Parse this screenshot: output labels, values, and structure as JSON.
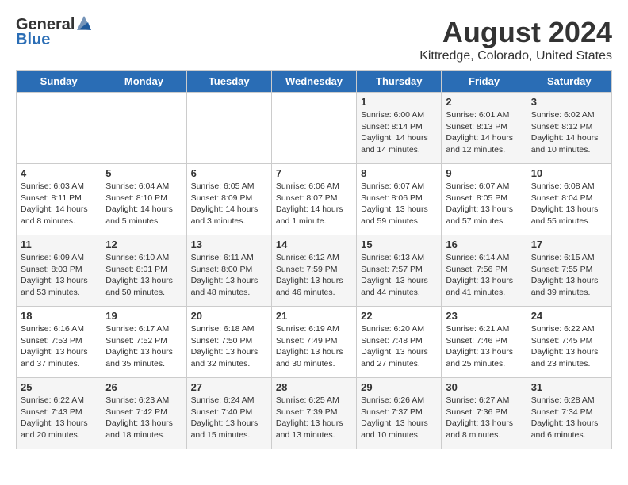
{
  "header": {
    "logo_general": "General",
    "logo_blue": "Blue",
    "month_year": "August 2024",
    "location": "Kittredge, Colorado, United States"
  },
  "days_of_week": [
    "Sunday",
    "Monday",
    "Tuesday",
    "Wednesday",
    "Thursday",
    "Friday",
    "Saturday"
  ],
  "weeks": [
    [
      {
        "date": "",
        "sunrise": "",
        "sunset": "",
        "daylight": ""
      },
      {
        "date": "",
        "sunrise": "",
        "sunset": "",
        "daylight": ""
      },
      {
        "date": "",
        "sunrise": "",
        "sunset": "",
        "daylight": ""
      },
      {
        "date": "",
        "sunrise": "",
        "sunset": "",
        "daylight": ""
      },
      {
        "date": "1",
        "sunrise": "6:00 AM",
        "sunset": "8:14 PM",
        "daylight": "14 hours and 14 minutes."
      },
      {
        "date": "2",
        "sunrise": "6:01 AM",
        "sunset": "8:13 PM",
        "daylight": "14 hours and 12 minutes."
      },
      {
        "date": "3",
        "sunrise": "6:02 AM",
        "sunset": "8:12 PM",
        "daylight": "14 hours and 10 minutes."
      }
    ],
    [
      {
        "date": "4",
        "sunrise": "6:03 AM",
        "sunset": "8:11 PM",
        "daylight": "14 hours and 8 minutes."
      },
      {
        "date": "5",
        "sunrise": "6:04 AM",
        "sunset": "8:10 PM",
        "daylight": "14 hours and 5 minutes."
      },
      {
        "date": "6",
        "sunrise": "6:05 AM",
        "sunset": "8:09 PM",
        "daylight": "14 hours and 3 minutes."
      },
      {
        "date": "7",
        "sunrise": "6:06 AM",
        "sunset": "8:07 PM",
        "daylight": "14 hours and 1 minute."
      },
      {
        "date": "8",
        "sunrise": "6:07 AM",
        "sunset": "8:06 PM",
        "daylight": "13 hours and 59 minutes."
      },
      {
        "date": "9",
        "sunrise": "6:07 AM",
        "sunset": "8:05 PM",
        "daylight": "13 hours and 57 minutes."
      },
      {
        "date": "10",
        "sunrise": "6:08 AM",
        "sunset": "8:04 PM",
        "daylight": "13 hours and 55 minutes."
      }
    ],
    [
      {
        "date": "11",
        "sunrise": "6:09 AM",
        "sunset": "8:03 PM",
        "daylight": "13 hours and 53 minutes."
      },
      {
        "date": "12",
        "sunrise": "6:10 AM",
        "sunset": "8:01 PM",
        "daylight": "13 hours and 50 minutes."
      },
      {
        "date": "13",
        "sunrise": "6:11 AM",
        "sunset": "8:00 PM",
        "daylight": "13 hours and 48 minutes."
      },
      {
        "date": "14",
        "sunrise": "6:12 AM",
        "sunset": "7:59 PM",
        "daylight": "13 hours and 46 minutes."
      },
      {
        "date": "15",
        "sunrise": "6:13 AM",
        "sunset": "7:57 PM",
        "daylight": "13 hours and 44 minutes."
      },
      {
        "date": "16",
        "sunrise": "6:14 AM",
        "sunset": "7:56 PM",
        "daylight": "13 hours and 41 minutes."
      },
      {
        "date": "17",
        "sunrise": "6:15 AM",
        "sunset": "7:55 PM",
        "daylight": "13 hours and 39 minutes."
      }
    ],
    [
      {
        "date": "18",
        "sunrise": "6:16 AM",
        "sunset": "7:53 PM",
        "daylight": "13 hours and 37 minutes."
      },
      {
        "date": "19",
        "sunrise": "6:17 AM",
        "sunset": "7:52 PM",
        "daylight": "13 hours and 35 minutes."
      },
      {
        "date": "20",
        "sunrise": "6:18 AM",
        "sunset": "7:50 PM",
        "daylight": "13 hours and 32 minutes."
      },
      {
        "date": "21",
        "sunrise": "6:19 AM",
        "sunset": "7:49 PM",
        "daylight": "13 hours and 30 minutes."
      },
      {
        "date": "22",
        "sunrise": "6:20 AM",
        "sunset": "7:48 PM",
        "daylight": "13 hours and 27 minutes."
      },
      {
        "date": "23",
        "sunrise": "6:21 AM",
        "sunset": "7:46 PM",
        "daylight": "13 hours and 25 minutes."
      },
      {
        "date": "24",
        "sunrise": "6:22 AM",
        "sunset": "7:45 PM",
        "daylight": "13 hours and 23 minutes."
      }
    ],
    [
      {
        "date": "25",
        "sunrise": "6:22 AM",
        "sunset": "7:43 PM",
        "daylight": "13 hours and 20 minutes."
      },
      {
        "date": "26",
        "sunrise": "6:23 AM",
        "sunset": "7:42 PM",
        "daylight": "13 hours and 18 minutes."
      },
      {
        "date": "27",
        "sunrise": "6:24 AM",
        "sunset": "7:40 PM",
        "daylight": "13 hours and 15 minutes."
      },
      {
        "date": "28",
        "sunrise": "6:25 AM",
        "sunset": "7:39 PM",
        "daylight": "13 hours and 13 minutes."
      },
      {
        "date": "29",
        "sunrise": "6:26 AM",
        "sunset": "7:37 PM",
        "daylight": "13 hours and 10 minutes."
      },
      {
        "date": "30",
        "sunrise": "6:27 AM",
        "sunset": "7:36 PM",
        "daylight": "13 hours and 8 minutes."
      },
      {
        "date": "31",
        "sunrise": "6:28 AM",
        "sunset": "7:34 PM",
        "daylight": "13 hours and 6 minutes."
      }
    ]
  ]
}
